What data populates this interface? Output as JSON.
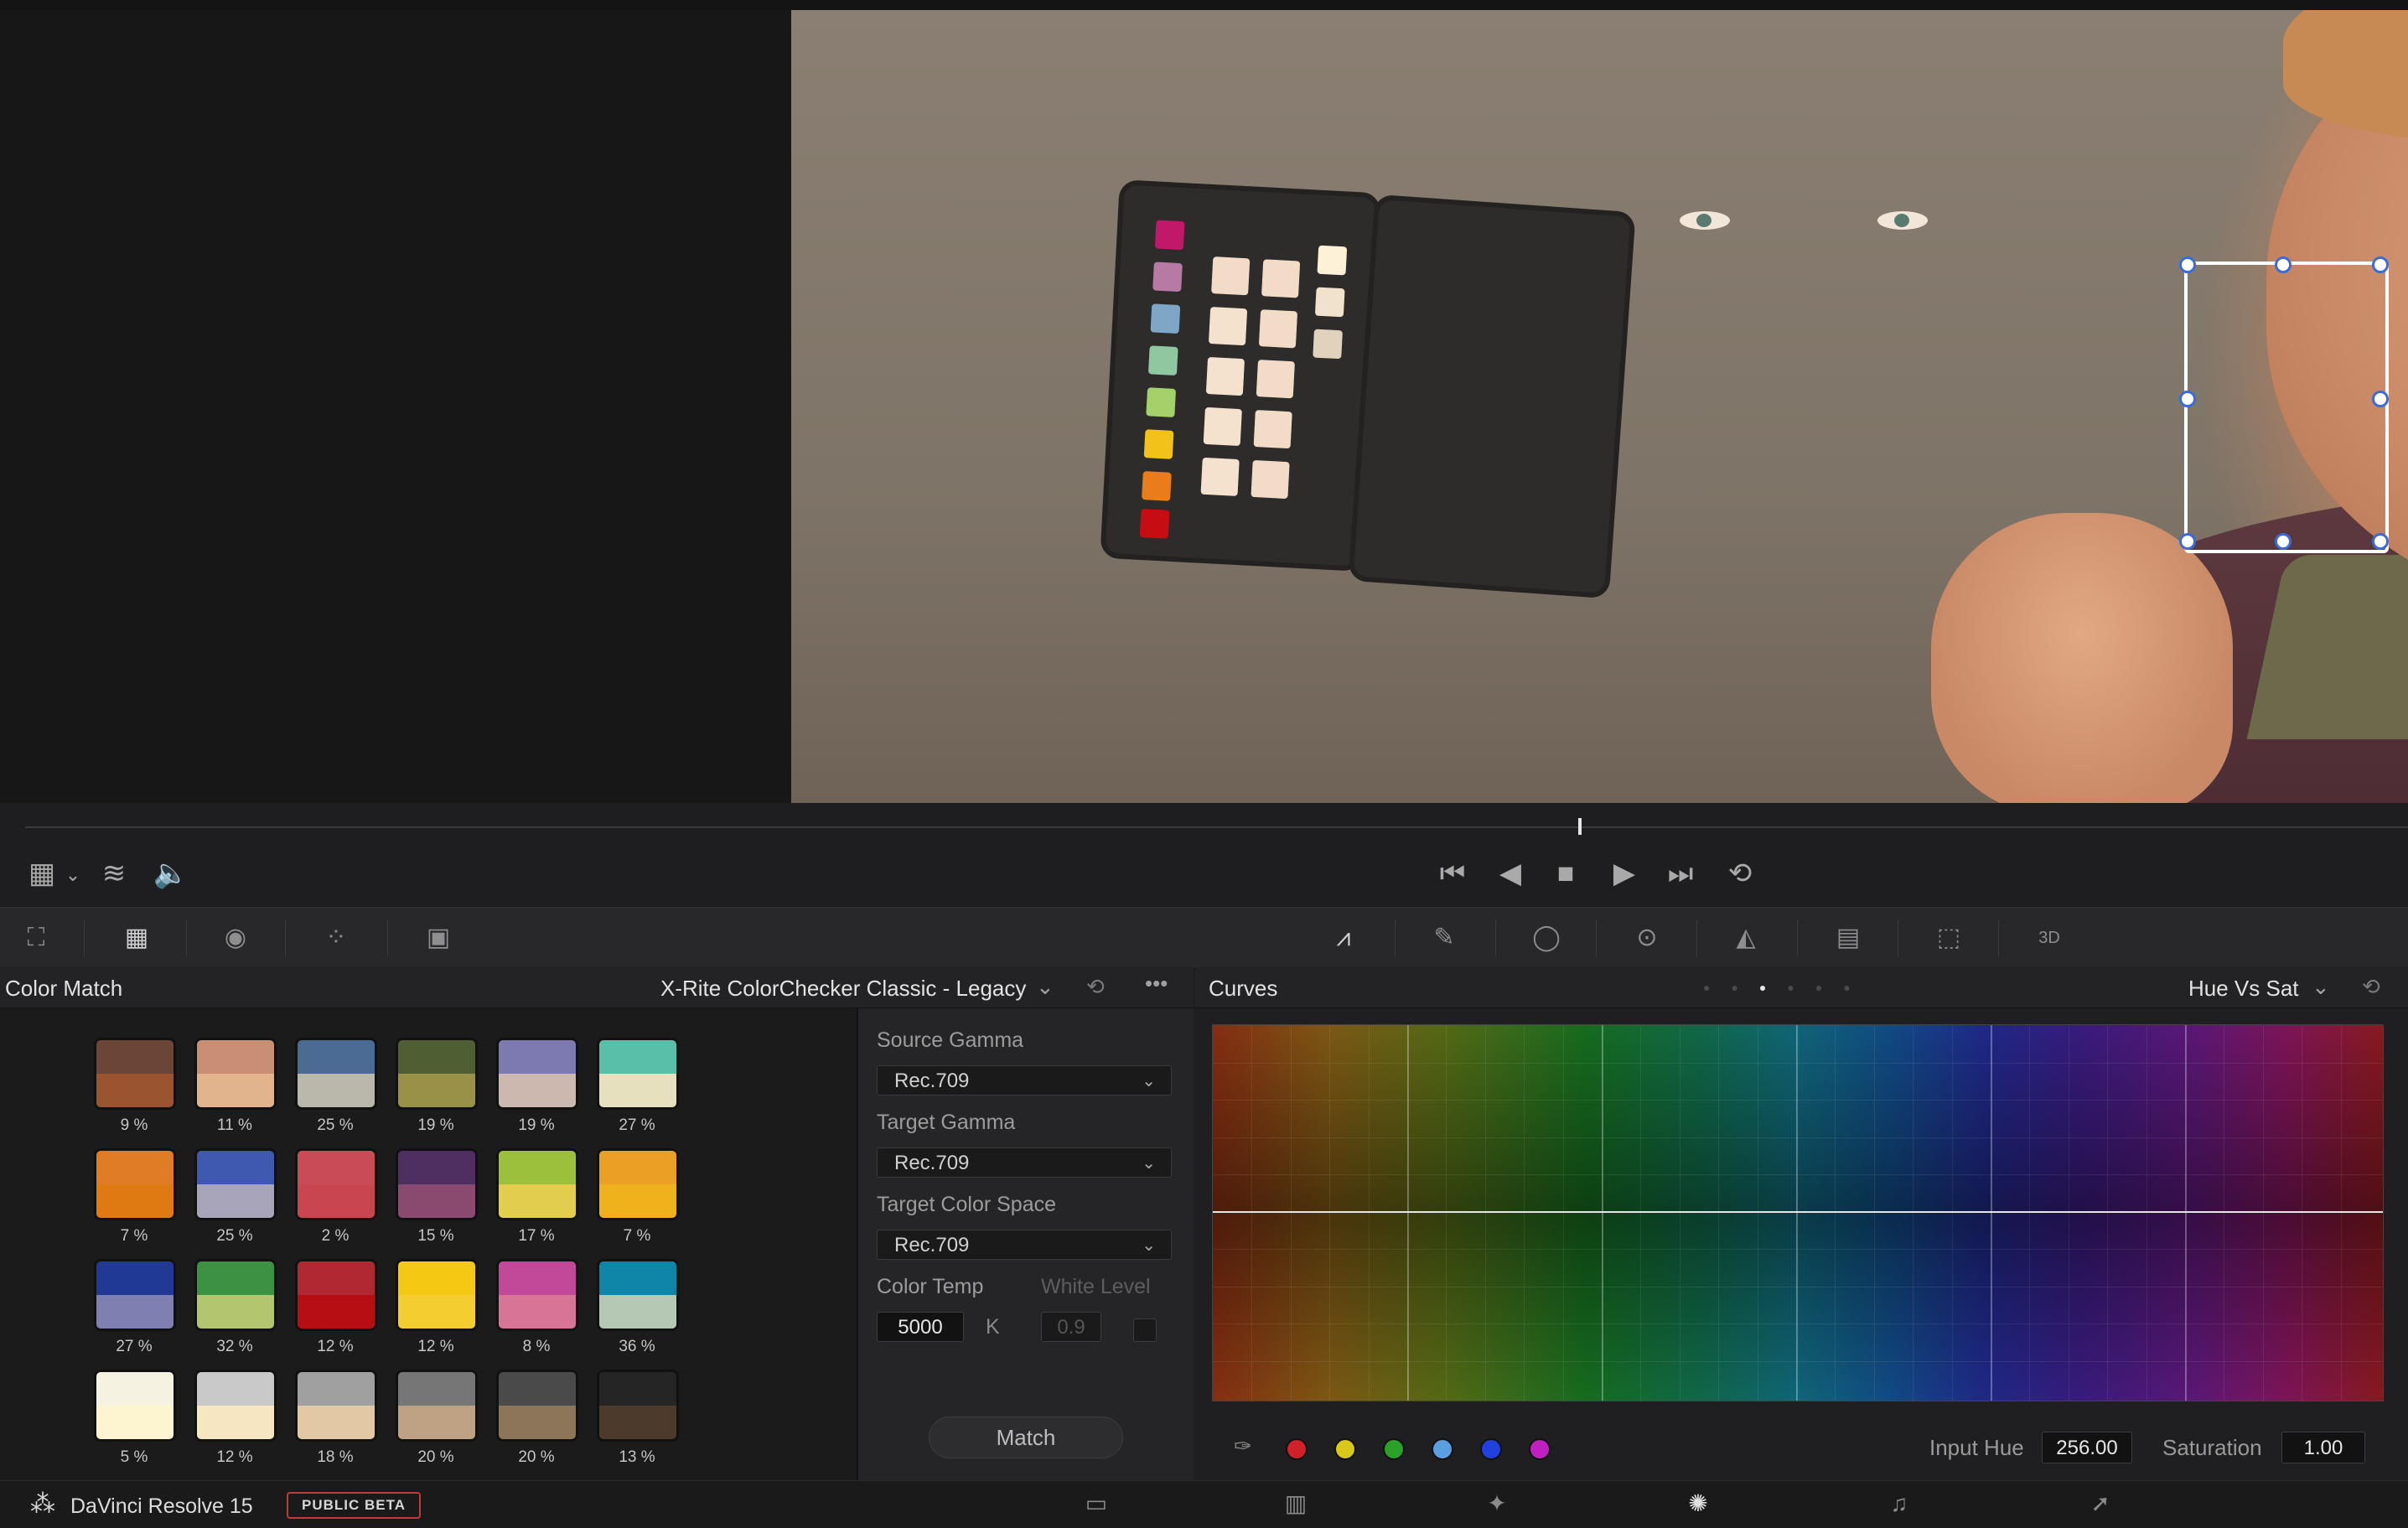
{
  "app": {
    "name": "DaVinci Resolve 15",
    "badge": "PUBLIC BETA"
  },
  "color_match": {
    "title": "Color Match",
    "chart_selector": "X-Rite ColorChecker Classic - Legacy",
    "swatches": [
      {
        "top": "#6b4535",
        "bottom": "#9a5530",
        "pct": "9 %"
      },
      {
        "top": "#c88f74",
        "bottom": "#e1b48d",
        "pct": "11 %"
      },
      {
        "top": "#4b6b94",
        "bottom": "#bab8aa",
        "pct": "25 %"
      },
      {
        "top": "#4f5f33",
        "bottom": "#9a9149",
        "pct": "19 %"
      },
      {
        "top": "#7c7ab0",
        "bottom": "#cdb8b0",
        "pct": "19 %"
      },
      {
        "top": "#5abfa9",
        "bottom": "#e6e0bf",
        "pct": "27 %"
      },
      {
        "top": "#e07b26",
        "bottom": "#dd7a12",
        "pct": "7 %"
      },
      {
        "top": "#4059b0",
        "bottom": "#a8a4b9",
        "pct": "25 %"
      },
      {
        "top": "#c94b57",
        "bottom": "#c94550",
        "pct": "2 %"
      },
      {
        "top": "#4f2f61",
        "bottom": "#8a4a70",
        "pct": "15 %"
      },
      {
        "top": "#9cc03b",
        "bottom": "#e3cd4c",
        "pct": "17 %"
      },
      {
        "top": "#ec9f25",
        "bottom": "#f0b21a",
        "pct": "7 %"
      },
      {
        "top": "#203a94",
        "bottom": "#7f80b2",
        "pct": "27 %"
      },
      {
        "top": "#3d9142",
        "bottom": "#b3c56e",
        "pct": "32 %"
      },
      {
        "top": "#b02831",
        "bottom": "#b70e14",
        "pct": "12 %"
      },
      {
        "top": "#f5c814",
        "bottom": "#f3ce2e",
        "pct": "12 %"
      },
      {
        "top": "#c2489a",
        "bottom": "#d87596",
        "pct": "8 %"
      },
      {
        "top": "#0f86a8",
        "bottom": "#b4c8b3",
        "pct": "36 %"
      },
      {
        "top": "#f6f2e2",
        "bottom": "#fdf5d0",
        "pct": "5 %"
      },
      {
        "top": "#c9c9c9",
        "bottom": "#f6e6c2",
        "pct": "12 %"
      },
      {
        "top": "#a0a0a0",
        "bottom": "#e3c8a5",
        "pct": "18 %"
      },
      {
        "top": "#767676",
        "bottom": "#bea283",
        "pct": "20 %"
      },
      {
        "top": "#4a4a4a",
        "bottom": "#8c7558",
        "pct": "20 %"
      },
      {
        "top": "#252525",
        "bottom": "#4c3b2c",
        "pct": "13 %"
      }
    ],
    "source_gamma": {
      "label": "Source Gamma",
      "value": "Rec.709"
    },
    "target_gamma": {
      "label": "Target Gamma",
      "value": "Rec.709"
    },
    "target_color_space": {
      "label": "Target Color Space",
      "value": "Rec.709"
    },
    "color_temp": {
      "label": "Color Temp",
      "value": "5000",
      "unit": "K"
    },
    "white_level": {
      "label": "White Level",
      "value": "0.9"
    },
    "match_label": "Match"
  },
  "curves": {
    "title": "Curves",
    "mode": "Hue Vs Sat",
    "input_hue_label": "Input Hue",
    "input_hue_value": "256.00",
    "saturation_label": "Saturation",
    "saturation_value": "1.00",
    "hue_dots": [
      "#d0202a",
      "#d8c81a",
      "#2aa22a",
      "#5aa0e0",
      "#2040e0",
      "#c020c0"
    ]
  }
}
